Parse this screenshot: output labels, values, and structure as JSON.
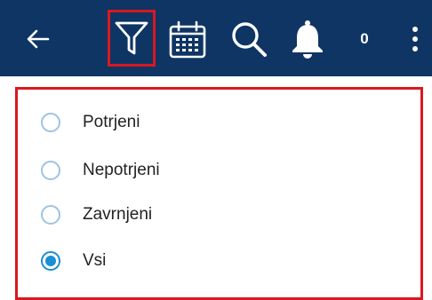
{
  "toolbar": {
    "background": "#0e3563",
    "icons": {
      "back": "arrow-left-icon",
      "filter": "filter-icon",
      "calendar": "calendar-icon",
      "search": "search-icon",
      "notifications": "bell-icon",
      "more": "more-vert-icon"
    },
    "notification_count": "0",
    "highlight_color": "#d9181f"
  },
  "filter_panel": {
    "selected_index": 3,
    "accent_color": "#1a8fd1",
    "options": [
      {
        "label": "Potrjeni",
        "selected": false
      },
      {
        "label": "Nepotrjeni",
        "selected": false
      },
      {
        "label": "Zavrnjeni",
        "selected": false
      },
      {
        "label": "Vsi",
        "selected": true
      }
    ]
  }
}
